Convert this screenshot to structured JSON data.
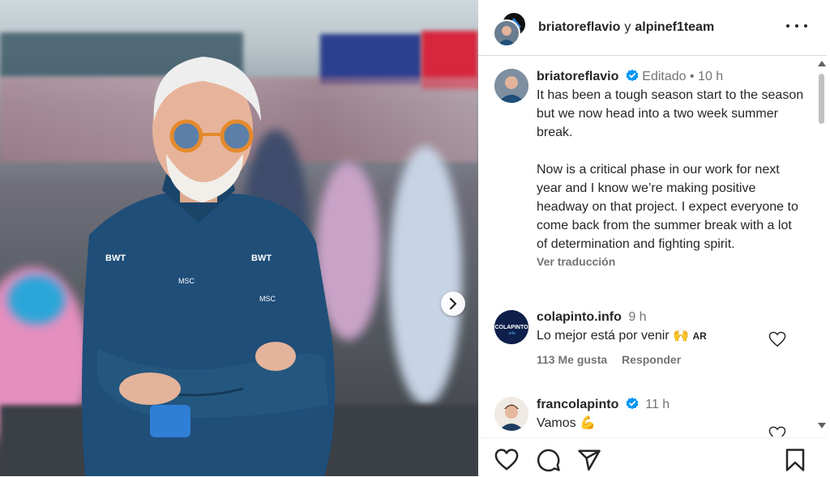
{
  "header": {
    "user1": "briatoreflavio",
    "connector": "y",
    "user2": "alpinef1team"
  },
  "caption": {
    "username": "briatoreflavio",
    "edited": "Editado",
    "dot": "•",
    "time": "10 h",
    "paragraph1": "It has been a tough season start to the season but we now head into a two week summer break.",
    "paragraph2": "Now is a critical phase in our work for next year and I know we’re making positive headway on that project. I expect everyone to come back from the summer break with a lot of determination and fighting spirit.",
    "translate": "Ver traducción"
  },
  "comments": [
    {
      "username": "colapinto.info",
      "time": "9 h",
      "text": "Lo mejor está por venir 🙌",
      "flag": "AR",
      "likes": "113 Me gusta",
      "reply": "Responder"
    },
    {
      "username": "francolapinto",
      "time": "11 h",
      "text": "Vamos 💪"
    }
  ],
  "colors": {
    "verified": "#0095f6",
    "text": "#262626",
    "muted": "#737373",
    "team_blue": "#1f4e79"
  },
  "icons": {
    "like": "heart-icon",
    "comment": "comment-icon",
    "share": "share-icon",
    "save": "bookmark-icon",
    "next": "chevron-right-icon",
    "more": "more-options-icon"
  }
}
